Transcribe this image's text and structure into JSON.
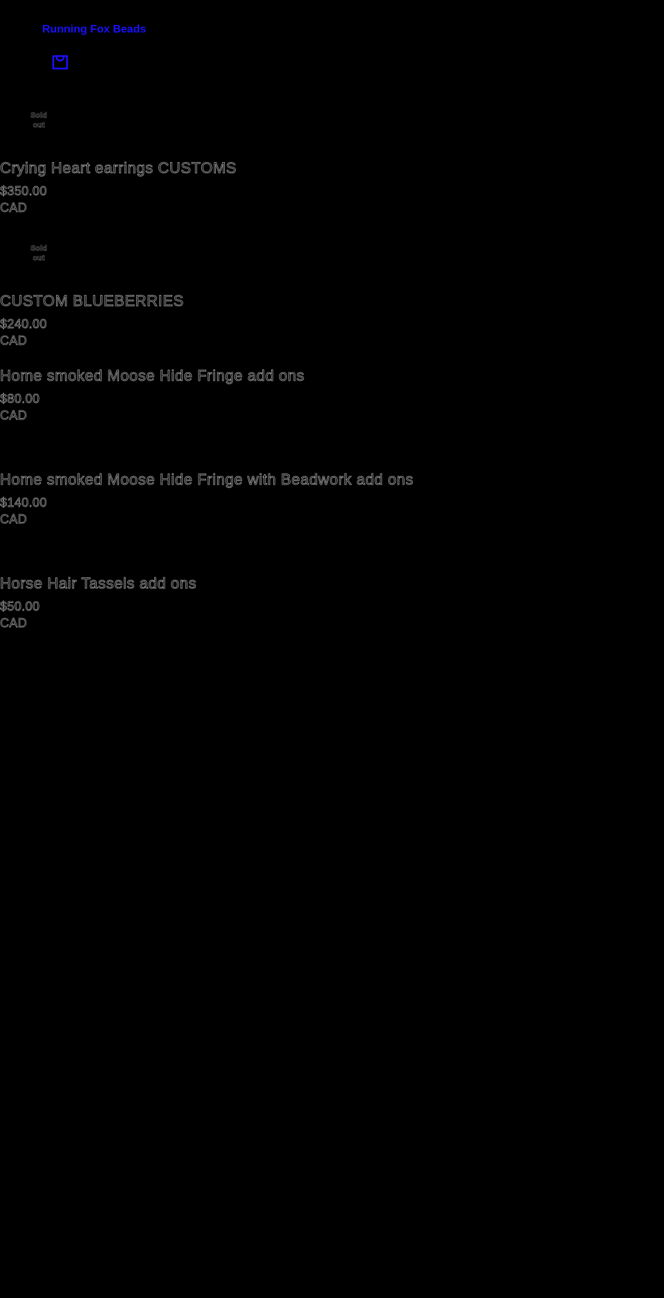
{
  "header": {
    "store_name": "Running Fox Beads",
    "cart_icon": "shopping-bag-icon"
  },
  "products": [
    {
      "badge": "Sold out",
      "title": "Crying Heart earrings CUSTOMS",
      "price": "$350.00 CAD"
    },
    {
      "badge": "Sold out",
      "title": "CUSTOM BLUEBERRIES",
      "price": "$240.00 CAD"
    },
    {
      "badge": "",
      "title": "Home smoked Moose Hide Fringe add ons",
      "price": "$80.00 CAD"
    },
    {
      "badge": "",
      "title": "Home smoked Moose Hide Fringe with Beadwork add ons",
      "price": "$140.00 CAD"
    },
    {
      "badge": "",
      "title": "Horse Hair Tassels add ons",
      "price": "$50.00 CAD"
    }
  ],
  "colors": {
    "background": "#000000",
    "link": "#1a10ff",
    "outline_text": "#a8a8a8"
  }
}
